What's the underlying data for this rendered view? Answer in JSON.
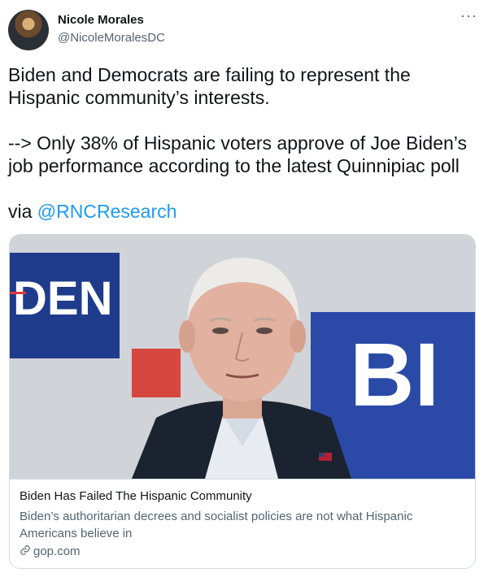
{
  "author": {
    "name": "Nicole Morales",
    "handle": "@NicoleMoralesDC"
  },
  "tweet": {
    "line1": "Biden and Democrats are failing to represent the Hispanic community’s interests.",
    "line2": "--> Only 38% of Hispanic voters approve of Joe Biden’s job performance according to the latest Quinnipiac poll",
    "via_prefix": "via ",
    "mention": "@RNCResearch"
  },
  "card": {
    "title": "Biden Has Failed The Hispanic Community",
    "description": "Biden’s authoritarian decrees and socialist policies are not what Hispanic Americans believe in",
    "domain": "gop.com",
    "sign_text_left": "DEN",
    "sign_text_right": "BI"
  },
  "icons": {
    "more": "more-icon",
    "link": "link-icon"
  },
  "colors": {
    "accent": "#1d9bf0",
    "secondary_text": "#536471",
    "border": "#cfd9de"
  }
}
